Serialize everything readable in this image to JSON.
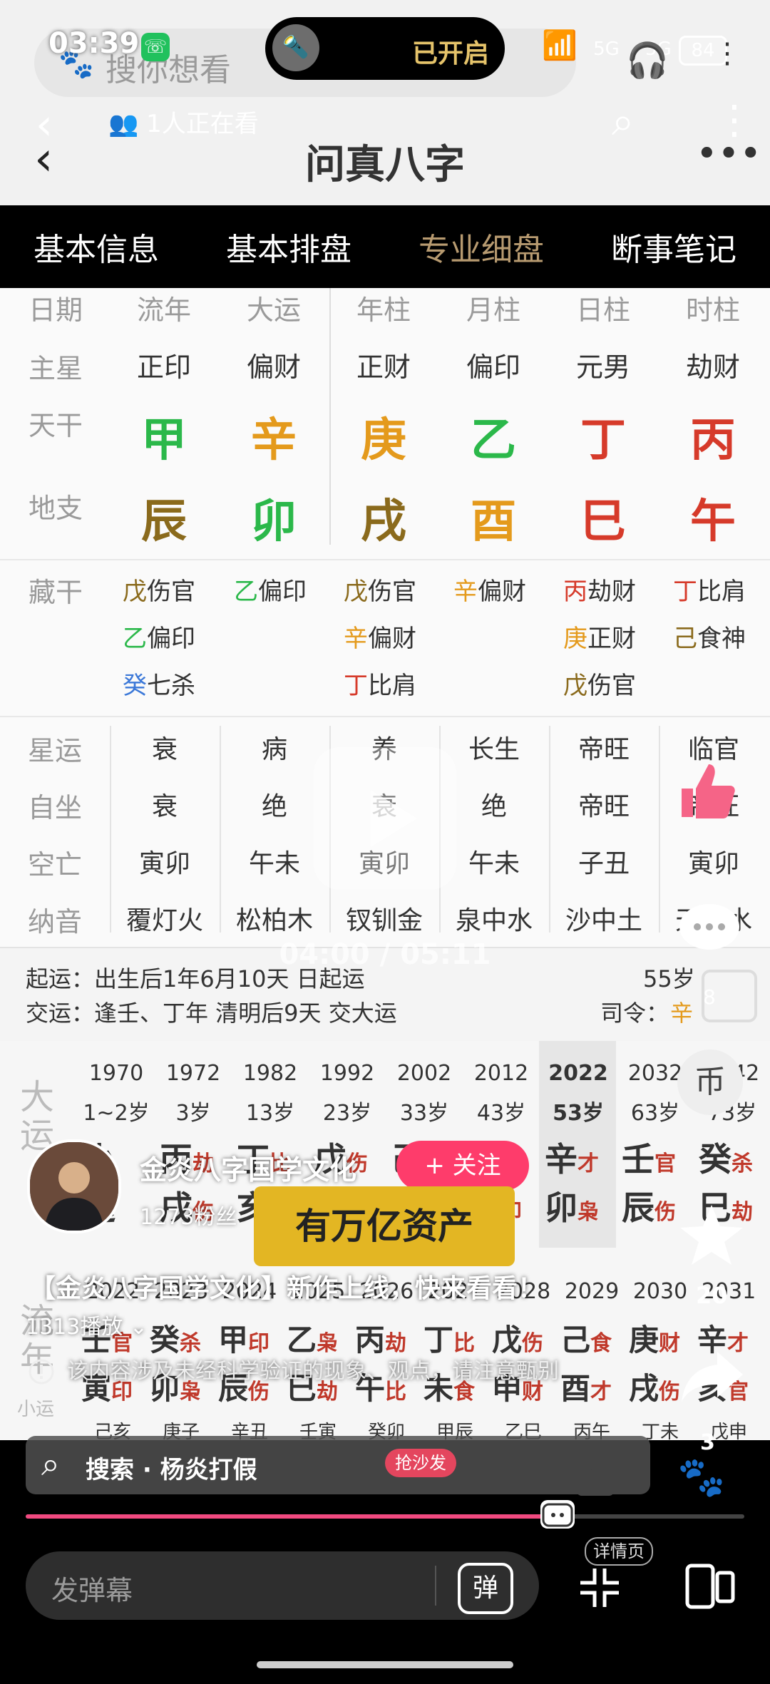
{
  "status": {
    "time": "03:39",
    "flashlight": "已开启",
    "signal_a": "5G",
    "signal_b": "5G",
    "battery": "84"
  },
  "top": {
    "search_placeholder": "搜你想看",
    "viewers": "1人正在看",
    "title": "问真八字"
  },
  "tabs": [
    "基本信息",
    "基本排盘",
    "专业细盘",
    "断事笔记"
  ],
  "chart": {
    "headers": [
      "日期",
      "流年",
      "大运",
      "年柱",
      "月柱",
      "日柱",
      "时柱"
    ],
    "row_labels": {
      "main_star": "主星",
      "tiangan": "天干",
      "dizhi": "地支"
    },
    "main_stars": [
      "正印",
      "偏财",
      "正财",
      "偏印",
      "元男",
      "劫财"
    ],
    "tiangan": [
      "甲",
      "辛",
      "庚",
      "乙",
      "丁",
      "丙"
    ],
    "dizhi": [
      "辰",
      "卯",
      "戌",
      "酉",
      "巳",
      "午"
    ]
  },
  "hidden_label": "藏干",
  "hidden": [
    [
      {
        "g": "戊",
        "t": "伤官"
      },
      {
        "g": "乙",
        "t": "偏印"
      },
      {
        "g": "癸",
        "t": "七杀"
      }
    ],
    [
      {
        "g": "乙",
        "t": "偏印"
      }
    ],
    [
      {
        "g": "戊",
        "t": "伤官"
      },
      {
        "g": "辛",
        "t": "偏财"
      },
      {
        "g": "丁",
        "t": "比肩"
      }
    ],
    [
      {
        "g": "辛",
        "t": "偏财"
      }
    ],
    [
      {
        "g": "丙",
        "t": "劫财"
      },
      {
        "g": "庚",
        "t": "正财"
      },
      {
        "g": "戊",
        "t": "伤官"
      }
    ],
    [
      {
        "g": "丁",
        "t": "比肩"
      },
      {
        "g": "己",
        "t": "食神"
      }
    ]
  ],
  "grid": {
    "labels": [
      "星运",
      "自坐",
      "空亡",
      "纳音"
    ],
    "rows": [
      [
        "衰",
        "病",
        "养",
        "长生",
        "帝旺",
        "临官"
      ],
      [
        "衰",
        "绝",
        "衰",
        "绝",
        "帝旺",
        "帝旺"
      ],
      [
        "寅卯",
        "午未",
        "寅卯",
        "午未",
        "子丑",
        "寅卯"
      ],
      [
        "覆灯火",
        "松柏木",
        "钗钏金",
        "泉中水",
        "沙中土",
        "天河水"
      ]
    ]
  },
  "qiyun": {
    "line1": "起运：出生后1年6月10天 日起运",
    "line2": "交运：逢壬、丁年 清明后9天 交大运",
    "age": "55岁",
    "siling_label": "司令：",
    "siling_val": "辛",
    "siling_num": "8"
  },
  "dayun": {
    "label": "大运",
    "years": [
      "1970",
      "1972",
      "1982",
      "1992",
      "2002",
      "2012",
      "2022",
      "2032",
      "2042"
    ],
    "ages": [
      "1~2岁",
      "3岁",
      "13岁",
      "23岁",
      "33岁",
      "43岁",
      "53岁",
      "63岁",
      "73岁"
    ],
    "stems": [
      {
        "a": "小",
        "b": ""
      },
      {
        "a": "丙",
        "b": "劫"
      },
      {
        "a": "丁",
        "b": "比"
      },
      {
        "a": "戊",
        "b": "伤"
      },
      {
        "a": "己",
        "b": "食"
      },
      {
        "a": "庚",
        "b": "财"
      },
      {
        "a": "辛",
        "b": "才"
      },
      {
        "a": "壬",
        "b": "官"
      },
      {
        "a": "癸",
        "b": "杀"
      }
    ],
    "branches": [
      {
        "a": "运",
        "b": ""
      },
      {
        "a": "戌",
        "b": "伤"
      },
      {
        "a": "亥",
        "b": "官"
      },
      {
        "a": "子",
        "b": "杀"
      },
      {
        "a": "丑",
        "b": "食"
      },
      {
        "a": "寅",
        "b": "印"
      },
      {
        "a": "卯",
        "b": "枭"
      },
      {
        "a": "辰",
        "b": "伤"
      },
      {
        "a": "巳",
        "b": "劫"
      }
    ]
  },
  "liunian": {
    "label": "流年",
    "small_label": "小运",
    "years": [
      "2022",
      "2023",
      "2024",
      "2025",
      "2026",
      "2027",
      "2028",
      "2029",
      "2030",
      "2031"
    ],
    "stems": [
      {
        "a": "壬",
        "b": "官"
      },
      {
        "a": "癸",
        "b": "杀"
      },
      {
        "a": "甲",
        "b": "印"
      },
      {
        "a": "乙",
        "b": "枭"
      },
      {
        "a": "丙",
        "b": "劫"
      },
      {
        "a": "丁",
        "b": "比"
      },
      {
        "a": "戊",
        "b": "伤"
      },
      {
        "a": "己",
        "b": "食"
      },
      {
        "a": "庚",
        "b": "财"
      },
      {
        "a": "辛",
        "b": "才"
      }
    ],
    "branches": [
      {
        "a": "寅",
        "b": "印"
      },
      {
        "a": "卯",
        "b": "枭"
      },
      {
        "a": "辰",
        "b": "伤"
      },
      {
        "a": "巳",
        "b": "劫"
      },
      {
        "a": "午",
        "b": "比"
      },
      {
        "a": "未",
        "b": "食"
      },
      {
        "a": "申",
        "b": "财"
      },
      {
        "a": "酉",
        "b": "才"
      },
      {
        "a": "戌",
        "b": "伤"
      },
      {
        "a": "亥",
        "b": "官"
      }
    ],
    "small": [
      "己亥",
      "庚子",
      "辛丑",
      "壬寅",
      "癸卯",
      "甲辰",
      "乙巳",
      "丙午",
      "丁未",
      "戊申"
    ]
  },
  "video": {
    "author": "金炎八字国学文化",
    "fans": "1273粉丝",
    "follow": "+ 关注",
    "caption": "有万亿资产",
    "title": "【金炎八字国学文化】新作上线，快来看看！",
    "plays": "1313播放",
    "disclaimer": "该内容涉及未经科学验证的现象、观点，请注意甄别",
    "time": "04:00 / 05:11",
    "search": "搜索 · 杨炎打假",
    "sofa": "抢沙发",
    "page_num": "1",
    "comment_count": "8",
    "star_count": "20",
    "share_count": "3",
    "danmu_placeholder": "发弹幕",
    "danmu_toggle": "弹",
    "detail": "详情页",
    "progress": 0.74
  },
  "colors": {
    "wood": "#2bb84a",
    "metal": "#e49a1c",
    "earth": "#8a6a1c",
    "fire": "#d63a2a",
    "water": "#3b78d8",
    "accent": "#fe3c6b"
  }
}
